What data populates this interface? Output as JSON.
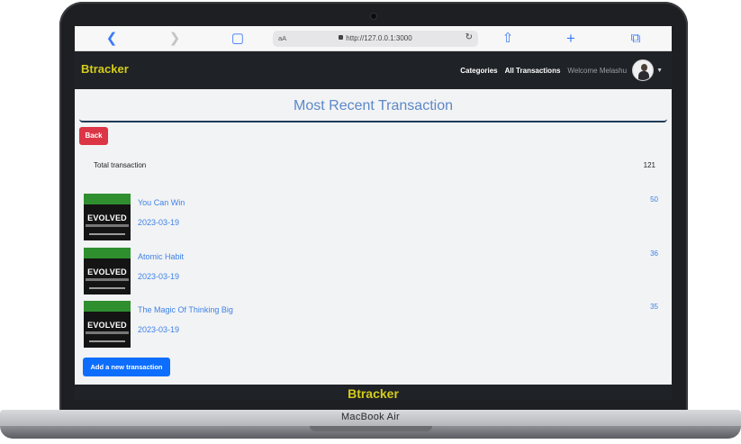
{
  "browser": {
    "url": "http://127.0.0.1:3000",
    "text_size_label": "aA"
  },
  "navbar": {
    "brand": "Btracker",
    "links": [
      "Categories",
      "All Transactions"
    ],
    "welcome": "Welcome Melashu"
  },
  "page": {
    "title": "Most Recent Transaction",
    "back_label": "Back",
    "total_label": "Total transaction",
    "total_value": "121",
    "add_label": "Add a new transaction"
  },
  "transactions": [
    {
      "name": "You Can Win",
      "date": "2023-03-19",
      "amount": "50"
    },
    {
      "name": "Atomic Habit",
      "date": "2023-03-19",
      "amount": "36"
    },
    {
      "name": "The Magic Of Thinking Big",
      "date": "2023-03-19",
      "amount": "35"
    }
  ],
  "cover": {
    "title": "EVOLVED"
  },
  "footer": {
    "brand": "Btracker"
  },
  "device": {
    "model": "MacBook Air"
  },
  "colors": {
    "brand": "#d4cc1b",
    "link": "#3e82e8",
    "danger": "#dc3545",
    "primary": "#0d6efd",
    "navbar": "#1f2226"
  }
}
